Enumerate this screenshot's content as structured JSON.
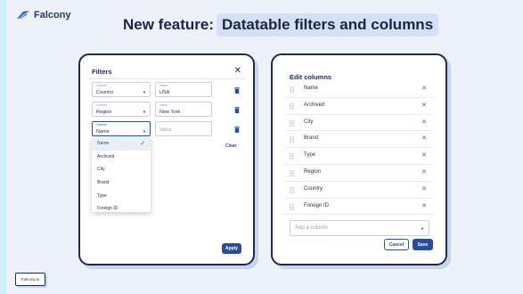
{
  "brand": {
    "name": "Falcony"
  },
  "headline": {
    "prefix": "New feature:",
    "highlight": "Datatable filters and columns"
  },
  "filters": {
    "title": "Filters",
    "rows": [
      {
        "column_label": "Column",
        "column_value": "Country",
        "value_label": "Value",
        "value": "USA"
      },
      {
        "column_label": "Column",
        "column_value": "Region",
        "value_label": "Value",
        "value": "New York"
      },
      {
        "column_label": "Column",
        "column_value": "Name",
        "value_placeholder": "Value"
      }
    ],
    "clear_label": "Clear",
    "dropdown_options": [
      "Name",
      "Archived",
      "City",
      "Brand",
      "Type",
      "Foreign ID"
    ],
    "apply_label": "Apply"
  },
  "columns": {
    "title": "Edit columns",
    "items": [
      "Name",
      "Archived",
      "City",
      "Brand",
      "Type",
      "Region",
      "Country",
      "Foreign ID"
    ],
    "add_placeholder": "Add a column",
    "cancel_label": "Cancel",
    "save_label": "Save"
  },
  "footer": {
    "badge": "Falcony.io"
  },
  "colors": {
    "accent": "#2e4d96",
    "background": "#ecf1fa",
    "highlight": "#d5e0f7",
    "border": "#1c2a50"
  }
}
